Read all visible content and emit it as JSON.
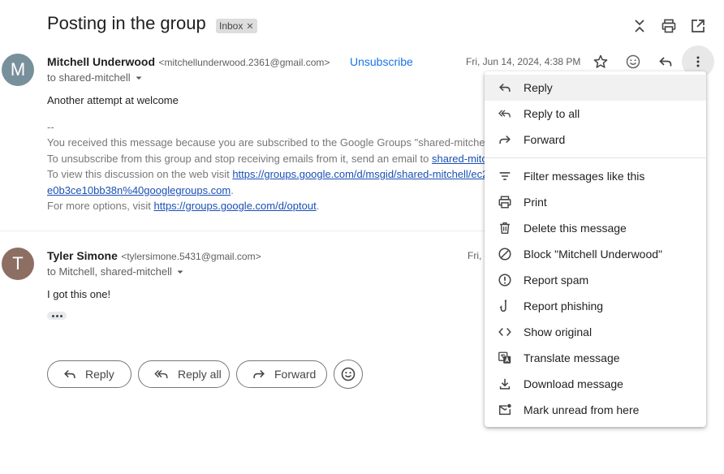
{
  "thread": {
    "subject": "Posting in the group",
    "label": "Inbox"
  },
  "messages": [
    {
      "avatar_letter": "M",
      "avatar_color": "#78909c",
      "sender_name": "Mitchell Underwood",
      "sender_email": "<mitchellunderwood.2361@gmail.com>",
      "unsubscribe_label": "Unsubscribe",
      "date": "Fri, Jun 14, 2024, 4:38 PM",
      "to": "to shared-mitchell",
      "body": "Another attempt at welcome",
      "sig_sep": "--",
      "sig_line1": "You received this message because you are subscribed to the Google Groups \"shared-mitche",
      "sig_line2_prefix": "To unsubscribe from this group and stop receiving emails from it, send an email to ",
      "sig_line2_link": "shared-mitc",
      "sig_line3_prefix": "To view this discussion on the web visit ",
      "sig_line3_link": "https://groups.google.com/d/msgid/shared-mitchell/ec2",
      "sig_line4_link": "e0b3ce10bb38n%40googlegroups.com",
      "sig_line4_suffix": ".",
      "sig_line5_prefix": "For more options, visit ",
      "sig_line5_link": "https://groups.google.com/d/optout",
      "sig_line5_suffix": "."
    },
    {
      "avatar_letter": "T",
      "avatar_color": "#8d6e63",
      "sender_name": "Tyler Simone",
      "sender_email": "<tylersimone.5431@gmail.com>",
      "date": "Fri, J",
      "to": "to Mitchell, shared-mitchell",
      "body": "I got this one!"
    }
  ],
  "actions": {
    "reply": "Reply",
    "reply_all": "Reply all",
    "forward": "Forward"
  },
  "menu": {
    "items": [
      {
        "label": "Reply",
        "icon": "reply-icon"
      },
      {
        "label": "Reply to all",
        "icon": "reply-all-icon"
      },
      {
        "label": "Forward",
        "icon": "forward-icon"
      },
      {
        "label": "Filter messages like this",
        "icon": "filter-icon"
      },
      {
        "label": "Print",
        "icon": "print-icon"
      },
      {
        "label": "Delete this message",
        "icon": "trash-icon"
      },
      {
        "label": "Block \"Mitchell Underwood\"",
        "icon": "block-icon"
      },
      {
        "label": "Report spam",
        "icon": "spam-icon"
      },
      {
        "label": "Report phishing",
        "icon": "phishing-hook-icon"
      },
      {
        "label": "Show original",
        "icon": "code-icon"
      },
      {
        "label": "Translate message",
        "icon": "translate-icon"
      },
      {
        "label": "Download message",
        "icon": "download-icon"
      },
      {
        "label": "Mark unread from here",
        "icon": "mark-unread-icon"
      }
    ]
  }
}
